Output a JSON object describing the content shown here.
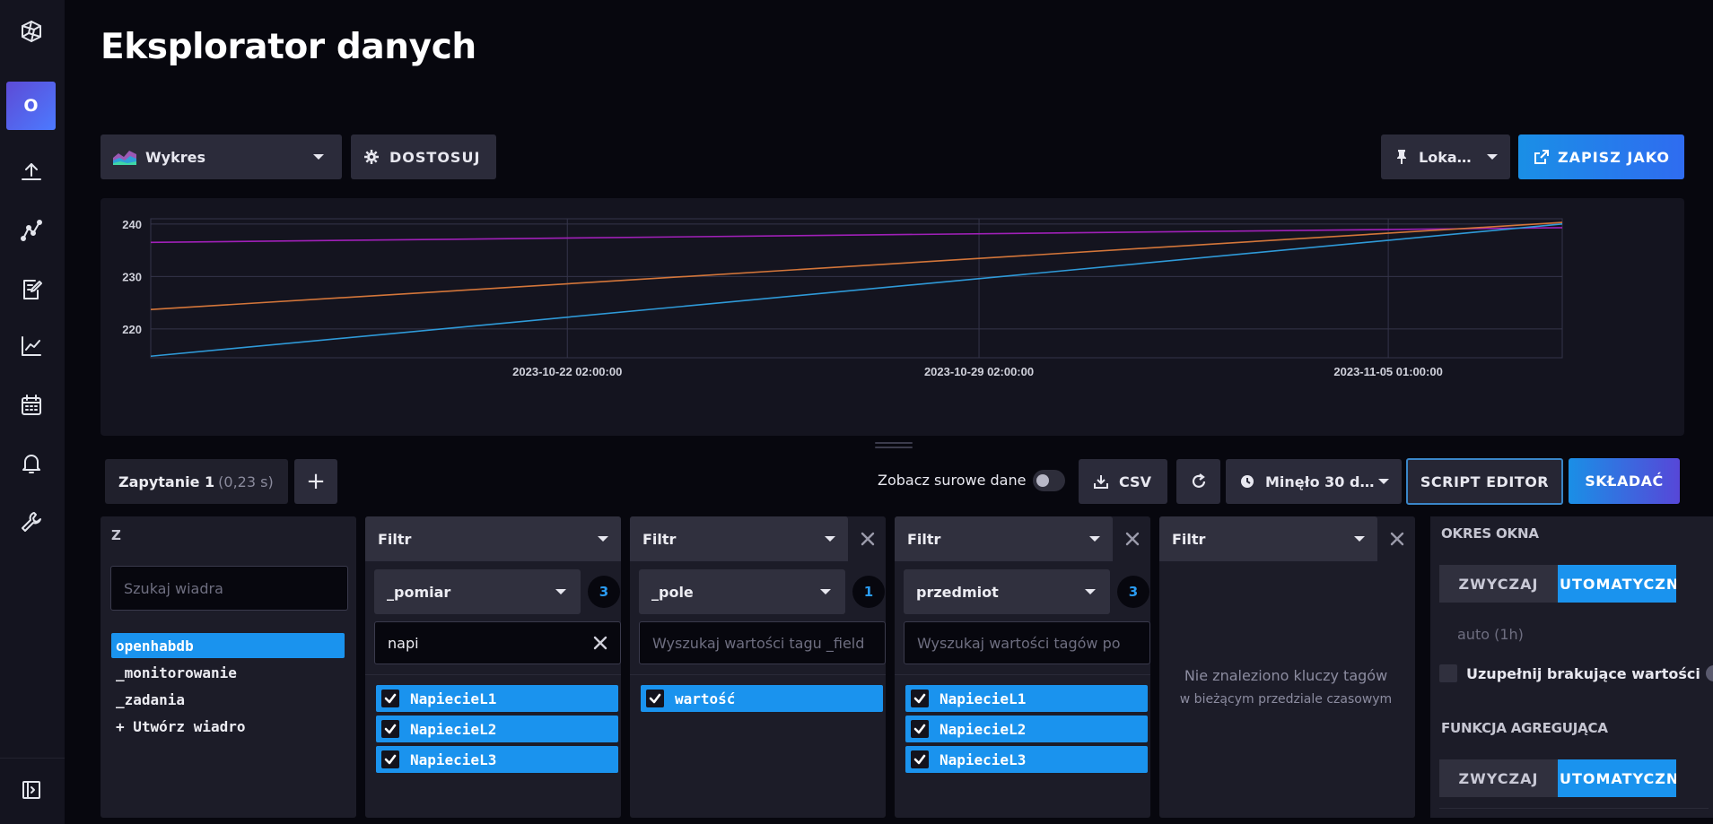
{
  "page": {
    "title": "Eksplorator danych"
  },
  "sidebar": {
    "org_initial": "O",
    "icons": [
      "logo-icon",
      "upload-icon",
      "graph-icon",
      "notebook-icon",
      "chart-icon",
      "calendar-icon",
      "bell-icon",
      "wrench-icon",
      "expand-icon"
    ]
  },
  "toolbar": {
    "viz_type": "Wykres",
    "customize": "DOSTOSUJ",
    "timezone": "Loka…",
    "save_as": "ZAPISZ JAKO"
  },
  "chart_data": {
    "type": "line",
    "x": [
      "2023-10-15",
      "2023-11-08"
    ],
    "x_ticks": [
      "2023-10-22 02:00:00",
      "2023-10-29 02:00:00",
      "2023-11-05 01:00:00"
    ],
    "y_ticks": [
      "220",
      "230",
      "240"
    ],
    "ylim": [
      214.5,
      241
    ],
    "grid": true,
    "series": [
      {
        "color": "#a020b8",
        "values": [
          236.5,
          239.3
        ]
      },
      {
        "color": "#d4763a",
        "values": [
          223.7,
          240.3
        ]
      },
      {
        "color": "#2f9ad8",
        "values": [
          214.8,
          240.0
        ]
      }
    ]
  },
  "query": {
    "tab_label": "Zapytanie 1",
    "tab_time": "(0,23 s)",
    "add_label": "+",
    "raw_data_label": "Zobacz surowe dane",
    "csv_label": "CSV",
    "time_range": "Minęło 30 d…",
    "script_editor": "SCRIPT EDITOR",
    "submit": "SKŁADAĆ"
  },
  "from_card": {
    "title": "Z",
    "search_placeholder": "Szukaj wiadra",
    "buckets": [
      "openhabdb",
      "_monitorowanie",
      "_zadania",
      "+ Utwórz wiadro"
    ]
  },
  "filters": [
    {
      "title": "Filtr",
      "key": "_pomiar",
      "count": "3",
      "search_value": "napi",
      "search_placeholder": "",
      "values": [
        "NapiecieL1",
        "NapiecieL2",
        "NapiecieL3"
      ]
    },
    {
      "title": "Filtr",
      "key": "_pole",
      "count": "1",
      "search_value": "",
      "search_placeholder": "Wyszukaj wartości tagu _field",
      "values": [
        "wartość"
      ]
    },
    {
      "title": "Filtr",
      "key": "przedmiot",
      "count": "3",
      "search_value": "",
      "search_placeholder": "Wyszukaj wartości tagów po",
      "values": [
        "NapiecieL1",
        "NapiecieL2",
        "NapiecieL3"
      ]
    },
    {
      "title": "Filtr",
      "empty_title": "Nie znaleziono kluczy tagów",
      "empty_sub": "w bieżącym przedziale czasowym"
    }
  ],
  "window_panel": {
    "period_heading": "OKRES OKNA",
    "custom_label": "ZWYCZAJ",
    "auto_label": "UTOMATYCZN",
    "period_placeholder": "auto (1h)",
    "fill_missing": "Uzupełnij brakujące wartości",
    "agg_heading": "FUNKCJA AGREGUJĄCA",
    "agg_custom": "ZWYCZAJ",
    "agg_auto": "UTOMATYCZN"
  }
}
